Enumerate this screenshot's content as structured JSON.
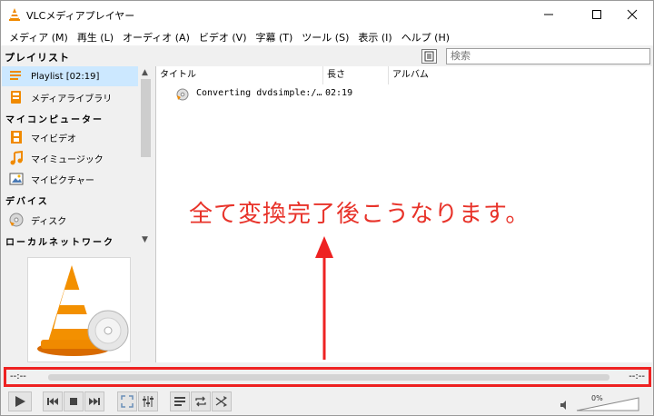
{
  "window": {
    "title": "VLCメディアプレイヤー"
  },
  "menu": [
    "メディア (M)",
    "再生 (L)",
    "オーディオ (A)",
    "ビデオ (V)",
    "字幕 (T)",
    "ツール (S)",
    "表示 (I)",
    "ヘルプ (H)"
  ],
  "playlist_header": {
    "title": "プレイリスト",
    "search_placeholder": "検索"
  },
  "sidebar": {
    "items": [
      {
        "label": "Playlist [02:19]",
        "icon": "playlist-icon"
      },
      {
        "label": "メディアライブラリ",
        "icon": "media-library-icon"
      }
    ],
    "sections": [
      {
        "title": "マイコンピューター",
        "items": [
          {
            "label": "マイビデオ",
            "icon": "video-icon"
          },
          {
            "label": "マイミュージック",
            "icon": "music-icon"
          },
          {
            "label": "マイピクチャー",
            "icon": "picture-icon"
          }
        ]
      },
      {
        "title": "デバイス",
        "items": [
          {
            "label": "ディスク",
            "icon": "disc-icon"
          }
        ]
      },
      {
        "title": "ローカルネットワーク",
        "items": []
      }
    ]
  },
  "columns": {
    "title": "タイトル",
    "length": "長さ",
    "album": "アルバム"
  },
  "rows": [
    {
      "title": "Converting dvdsimple:/…",
      "length": "02:19"
    }
  ],
  "annotation": "全て変換完了後こうなります。",
  "seek": {
    "time_left": "--:--",
    "time_right": "--:--"
  },
  "volume": {
    "percent": "0%"
  },
  "colors": {
    "annotation": "#e8332a",
    "highlight_border": "#ee2222",
    "selected": "#cce8ff"
  }
}
